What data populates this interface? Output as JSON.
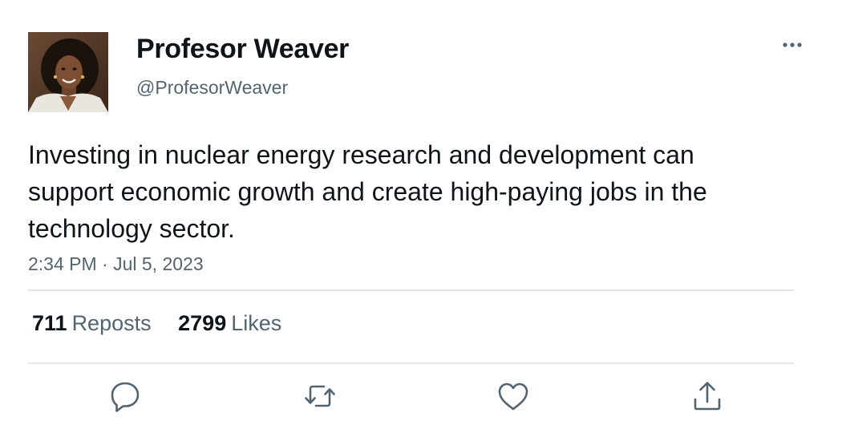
{
  "author": {
    "display_name": "Profesor Weaver",
    "handle": "@ProfesorWeaver",
    "avatar": "profile-photo"
  },
  "tweet": {
    "text": "Investing in nuclear energy research and development can support economic growth and create high-paying jobs in the technology sector.",
    "timestamp": "2:34 PM · Jul 5, 2023"
  },
  "stats": {
    "reposts_count": "711",
    "reposts_label": "Reposts",
    "likes_count": "2799",
    "likes_label": "Likes"
  },
  "actions": [
    {
      "icon": "reply-icon"
    },
    {
      "icon": "repost-icon"
    },
    {
      "icon": "like-icon"
    },
    {
      "icon": "share-icon"
    }
  ],
  "menu": {
    "icon": "more-options-icon"
  },
  "colors": {
    "text": "#0f1419",
    "secondary": "#536471",
    "divider": "#e3e6e8",
    "icon": "#536471"
  }
}
